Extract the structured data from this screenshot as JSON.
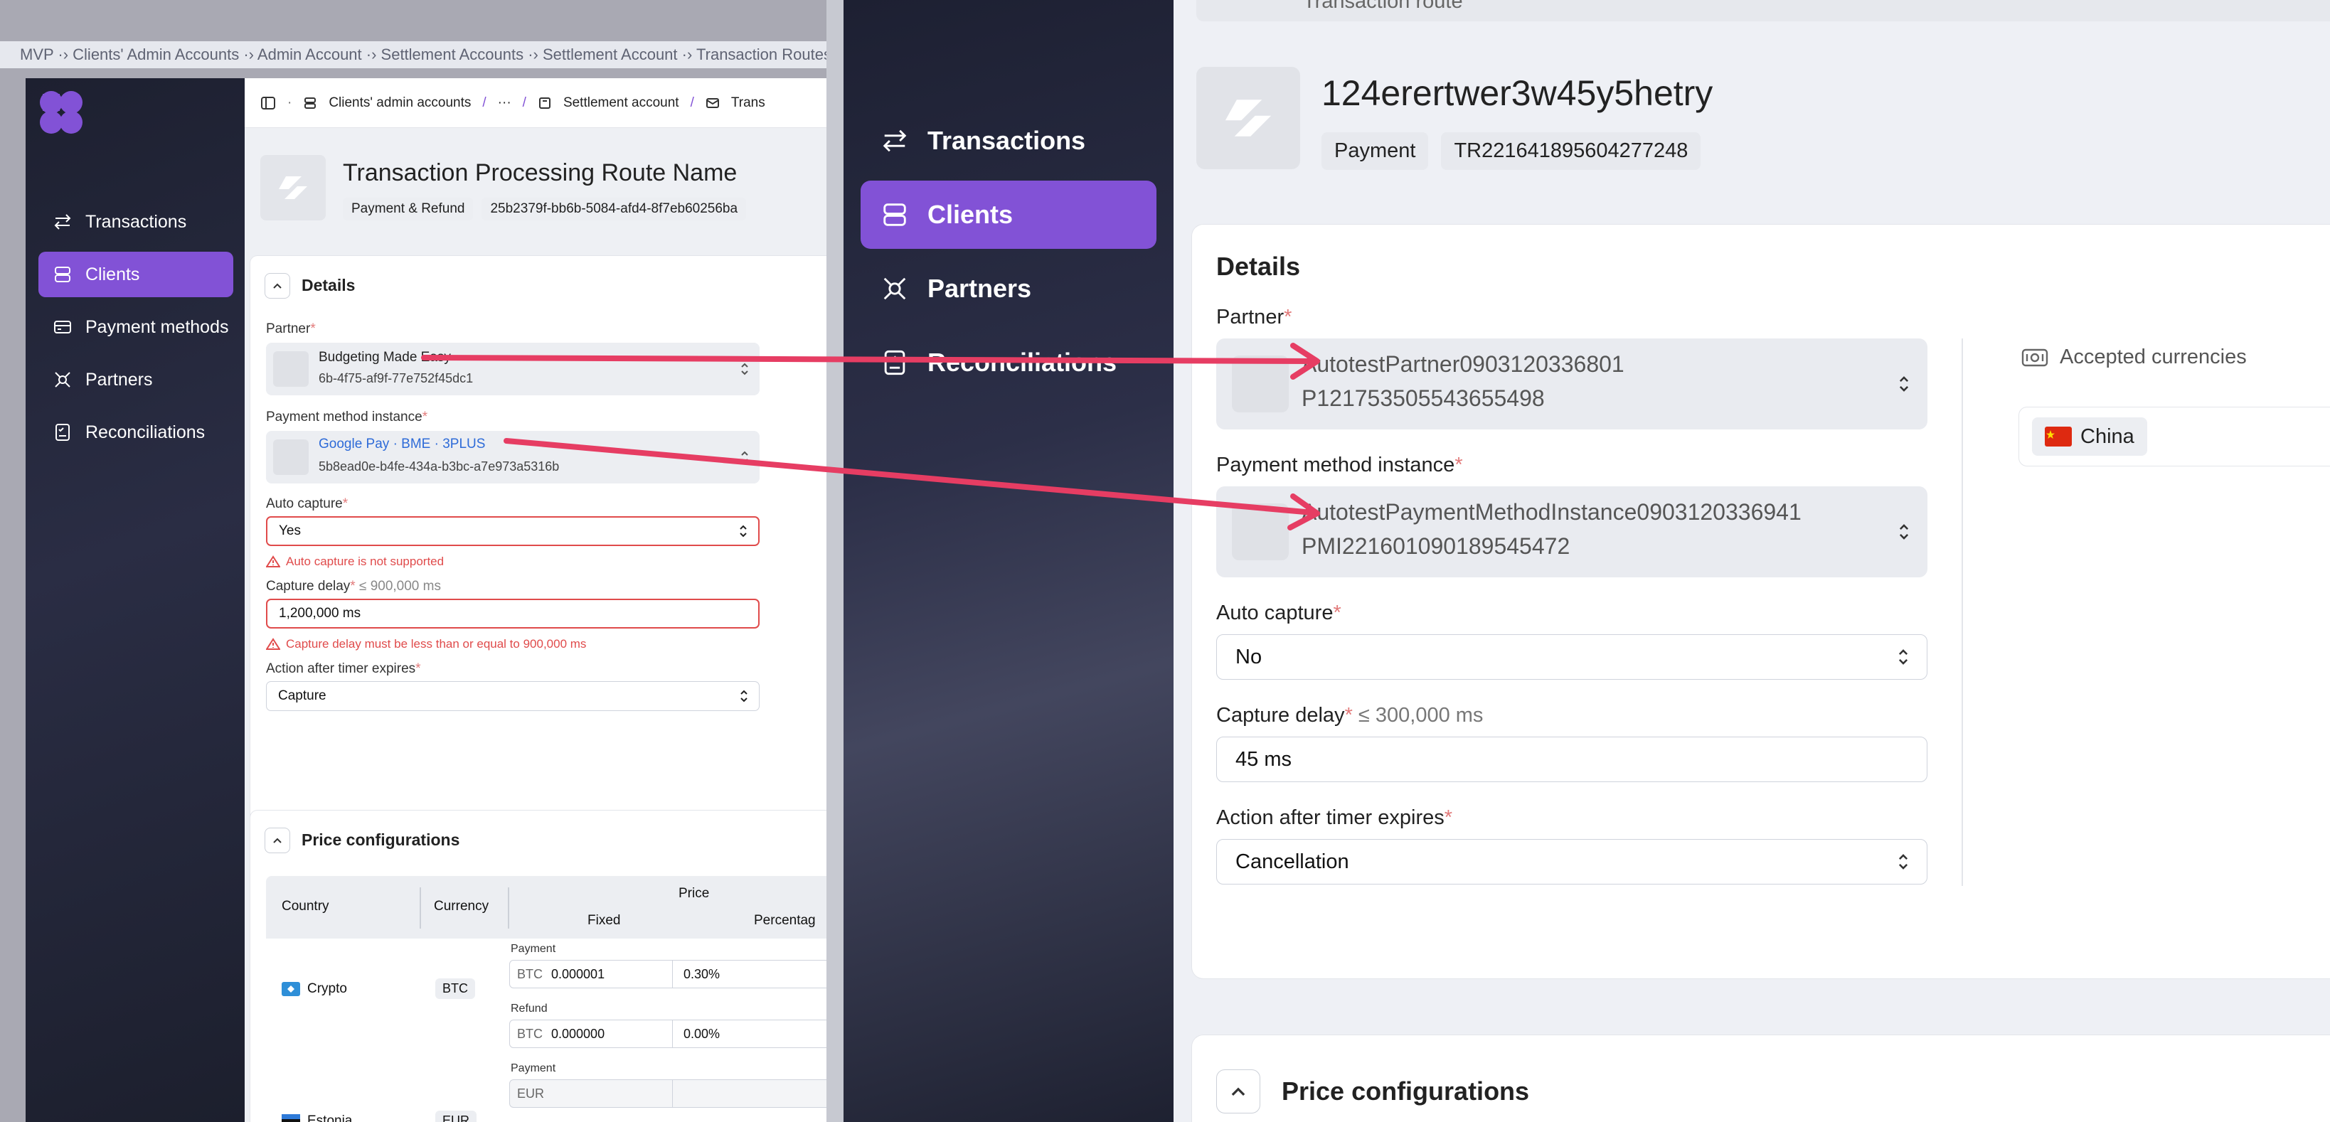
{
  "breadcrumb": "MVP ·› Clients' Admin Accounts ·› Admin Account ·› Settlement Accounts ·› Settlement Account ·› Transaction Routes ·› Tr",
  "left": {
    "nav": [
      {
        "label": "Transactions",
        "icon": "arrows-exchange-icon",
        "active": false
      },
      {
        "label": "Clients",
        "icon": "database-icon",
        "active": true
      },
      {
        "label": "Payment methods",
        "icon": "card-icon",
        "active": false
      },
      {
        "label": "Partners",
        "icon": "network-icon",
        "active": false
      },
      {
        "label": "Reconciliations",
        "icon": "checklist-icon",
        "active": false
      }
    ],
    "topbar": {
      "crumb1": "Clients' admin accounts",
      "sep": "/",
      "more": "···",
      "crumb2": "Settlement account",
      "crumb3": "Trans"
    },
    "route": {
      "title": "Transaction Processing Route Name",
      "type_tag": "Payment & Refund",
      "id_tag": "25b2379f-bb6b-5084-afd4-8f7eb60256ba"
    },
    "details": {
      "heading": "Details",
      "partner_label": "Partner",
      "partner_name": "Budgeting Made Easy",
      "partner_id": "6b-4f75-af9f-77e752f45dc1",
      "pmi_label": "Payment method instance",
      "pmi_name": "Google Pay · BME · 3PLUS",
      "pmi_id": "5b8ead0e-b4fe-434a-b3bc-a7e973a5316b",
      "auto_capture_label": "Auto capture",
      "auto_capture_value": "Yes",
      "auto_capture_error": "Auto capture is not supported",
      "capture_delay_label": "Capture delay",
      "capture_delay_hint": "≤ 900,000 ms",
      "capture_delay_value": "1,200,000 ms",
      "capture_delay_error": "Capture delay must be less than or equal to 900,000 ms",
      "action_label": "Action after timer expires",
      "action_value": "Capture",
      "required": "*"
    },
    "price": {
      "heading": "Price configurations",
      "col_country": "Country",
      "col_currency": "Currency",
      "col_price": "Price",
      "col_fixed": "Fixed",
      "col_percentage": "Percentag",
      "rows": [
        {
          "country": "Crypto",
          "currency": "BTC",
          "payment_label": "Payment",
          "payment_cur": "BTC",
          "payment_fixed": "0.000001",
          "payment_pct": "0.30%",
          "refund_label": "Refund",
          "refund_cur": "BTC",
          "refund_fixed": "0.000000",
          "refund_pct": "0.00%"
        },
        {
          "country": "Estonia",
          "currency": "EUR",
          "payment_label": "Payment",
          "payment_cur": "EUR"
        }
      ]
    }
  },
  "right": {
    "nav": [
      {
        "label": "Transactions",
        "icon": "arrows-exchange-icon",
        "active": false
      },
      {
        "label": "Clients",
        "icon": "database-icon",
        "active": true
      },
      {
        "label": "Partners",
        "icon": "network-icon",
        "active": false
      },
      {
        "label": "Reconciliations",
        "icon": "checklist-icon",
        "active": false
      }
    ],
    "top_chip": "Transaction route",
    "route": {
      "title": "124erertwer3w45y5hetry",
      "type_tag": "Payment",
      "id_tag": "TR221641895604277248"
    },
    "details": {
      "heading": "Details",
      "partner_label": "Partner",
      "partner_name": "AutotestPartner0903120336801",
      "partner_id": "P121753505543655498",
      "pmi_label": "Payment method instance",
      "pmi_name": "AutotestPaymentMethodInstance0903120336941",
      "pmi_id": "PMI221601090189545472",
      "auto_capture_label": "Auto capture",
      "auto_capture_value": "No",
      "capture_delay_label": "Capture delay",
      "capture_delay_hint": "≤ 300,000 ms",
      "capture_delay_value": "45 ms",
      "action_label": "Action after timer expires",
      "action_value": "Cancellation",
      "required": "*",
      "accepted_currencies_label": "Accepted currencies",
      "country_chip": "China"
    },
    "price": {
      "heading": "Price configurations"
    }
  },
  "colors": {
    "accent": "#8252d6",
    "error": "#e04b4b",
    "arrow": "#e63d63",
    "link": "#2e6bd8"
  }
}
